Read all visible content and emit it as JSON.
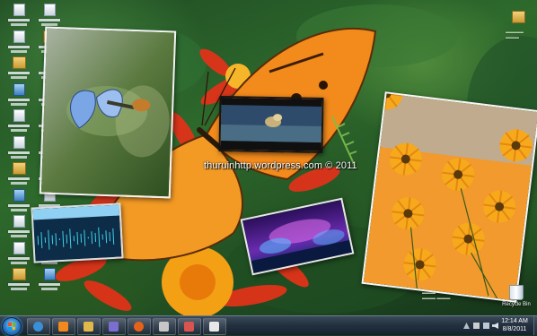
{
  "watermark": "thuruinhttp.wordpress.com © 2011",
  "recycle_bin": {
    "label": "Recycle Bin",
    "icon": "recycle-bin-icon"
  },
  "clock": {
    "time": "12:14 AM",
    "date": "8/8/2011"
  },
  "taskbar": {
    "start_icon": "windows-start-orb",
    "pinned": [
      {
        "name": "internet-explorer",
        "icon": "ie-icon",
        "color": "#3a8fd8"
      },
      {
        "name": "media-player",
        "icon": "media-player-icon",
        "color": "#f08a1e"
      },
      {
        "name": "windows-explorer",
        "icon": "folder-icon",
        "color": "#e2b84a"
      },
      {
        "name": "app-4",
        "icon": "app-icon",
        "color": "#7a6fd0"
      },
      {
        "name": "firefox",
        "icon": "firefox-icon",
        "color": "#e5621a"
      },
      {
        "name": "app-6",
        "icon": "app-icon",
        "color": "#c7c7c7"
      },
      {
        "name": "app-7",
        "icon": "app-icon",
        "color": "#d9534f"
      },
      {
        "name": "app-8",
        "icon": "app-icon",
        "color": "#e8e8e8"
      }
    ],
    "tray_icons": [
      "up-arrow-icon",
      "flag-icon",
      "network-icon",
      "volume-icon"
    ]
  },
  "desktop_icons": [
    {
      "name": "desktop-icon",
      "icon": "document-icon"
    },
    {
      "name": "desktop-icon",
      "icon": "document-icon"
    },
    {
      "name": "desktop-icon",
      "icon": "folder-icon"
    },
    {
      "name": "desktop-icon",
      "icon": "app-icon"
    }
  ],
  "colors": {
    "butterfly": "#f28a1c",
    "taskbar": "#1d2b3a"
  }
}
